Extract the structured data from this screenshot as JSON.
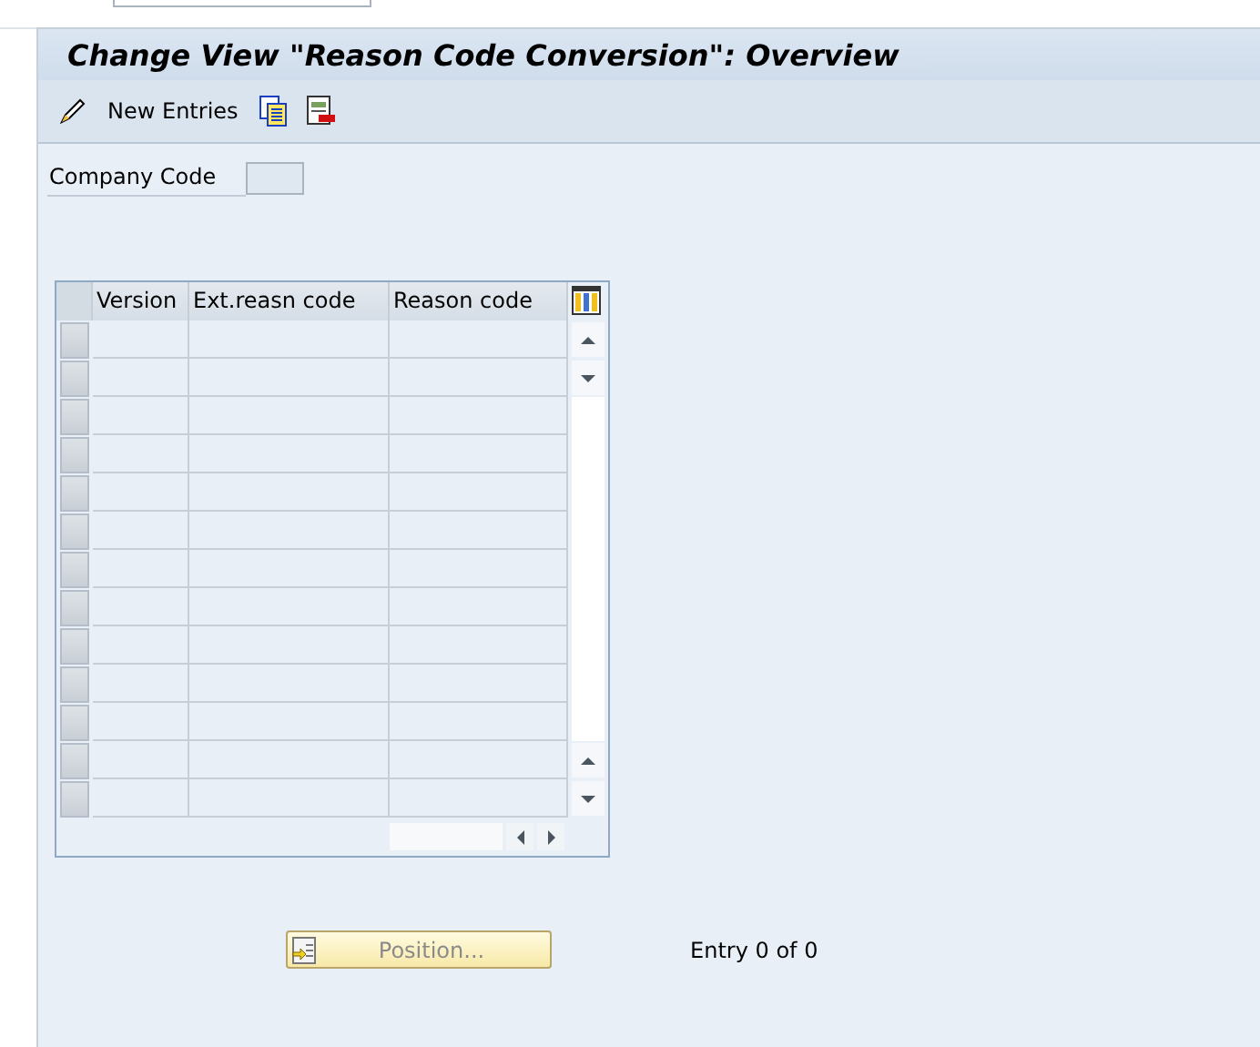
{
  "title": "Change View \"Reason Code Conversion\": Overview",
  "toolbar": [
    {
      "kind": "icon"
    },
    {
      "kind": "text",
      "label": "New Entries"
    },
    {
      "kind": "icon"
    },
    {
      "kind": "icon"
    }
  ],
  "company_code": {
    "label": "Company Code"
  },
  "table": {
    "columns": [
      "Version",
      "Ext.reasn code",
      "Reason code"
    ],
    "rows": [
      {
        "selected": false
      },
      {
        "selected": false
      },
      {
        "selected": false
      },
      {
        "selected": false
      },
      {
        "selected": false
      },
      {
        "selected": false
      },
      {
        "selected": false
      },
      {
        "selected": false
      },
      {
        "selected": false
      },
      {
        "selected": false
      },
      {
        "selected": false
      },
      {
        "selected": false
      },
      {
        "selected": false
      }
    ]
  },
  "position_button": {
    "label": "Position...",
    "disabled": true
  },
  "entry_count": "Entry 0 of 0"
}
